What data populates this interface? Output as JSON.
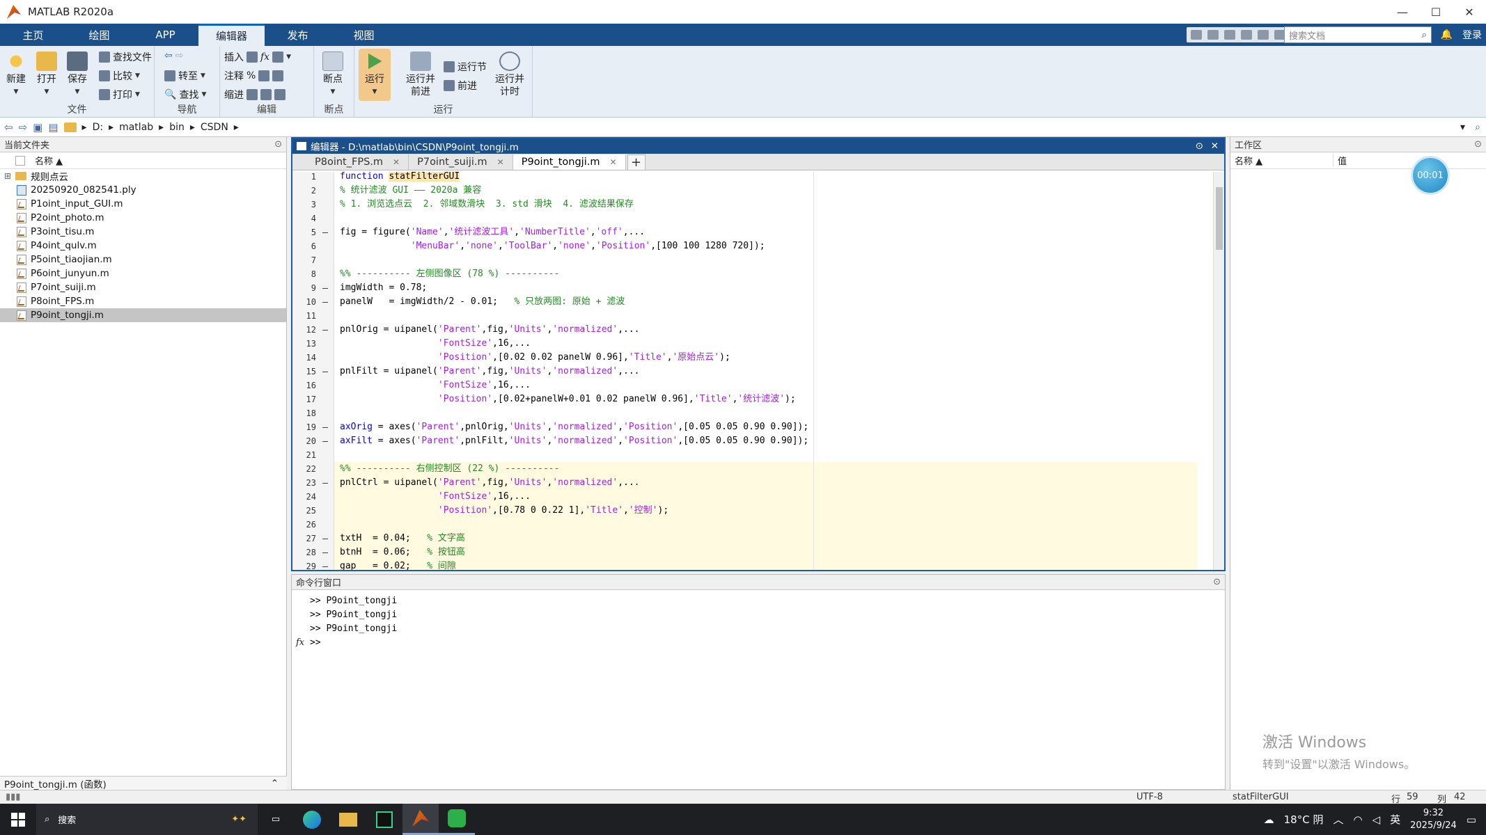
{
  "window": {
    "title": "MATLAB R2020a"
  },
  "ribbon_tabs": [
    "主页",
    "绘图",
    "APP",
    "编辑器",
    "发布",
    "视图"
  ],
  "active_tab": "编辑器",
  "search": {
    "placeholder": "搜索文档"
  },
  "login_label": "登录",
  "ribbon": {
    "file_group": {
      "label": "文件",
      "new": "新建",
      "open": "打开",
      "save": "保存",
      "find_files": "查找文件",
      "compare": "比较",
      "print": "打印"
    },
    "nav_group": {
      "label": "导航",
      "goto": "转至",
      "find": "查找"
    },
    "edit_group": {
      "label": "编辑",
      "insert": "插入",
      "comment": "注释",
      "indent": "缩进",
      "fx": "fx",
      "percent": "%"
    },
    "breakpoints_group": {
      "label": "断点",
      "breakpoints": "断点"
    },
    "run_group": {
      "label": "运行",
      "run": "运行",
      "run_advance_1": "运行并",
      "run_advance_2": "前进",
      "run_section": "运行节",
      "advance": "前进",
      "run_time_1": "运行并",
      "run_time_2": "计时"
    }
  },
  "address": {
    "path": [
      "D:",
      "matlab",
      "bin",
      "CSDN"
    ]
  },
  "current_folder": {
    "title": "当前文件夹",
    "col_name": "名称 ▲",
    "items": [
      {
        "name": "规则点云",
        "kind": "folder"
      },
      {
        "name": "20250920_082541.ply",
        "kind": "ply"
      },
      {
        "name": "P1oint_input_GUI.m",
        "kind": "m"
      },
      {
        "name": "P2oint_photo.m",
        "kind": "m"
      },
      {
        "name": "P3oint_tisu.m",
        "kind": "m"
      },
      {
        "name": "P4oint_qulv.m",
        "kind": "m"
      },
      {
        "name": "P5oint_tiaojian.m",
        "kind": "m"
      },
      {
        "name": "P6oint_junyun.m",
        "kind": "m"
      },
      {
        "name": "P7oint_suiji.m",
        "kind": "m"
      },
      {
        "name": "P8oint_FPS.m",
        "kind": "m"
      },
      {
        "name": "P9oint_tongji.m",
        "kind": "m",
        "selected": true
      }
    ],
    "details": "P9oint_tongji.m  (函数)"
  },
  "editor": {
    "title": "编辑器 - D:\\matlab\\bin\\CSDN\\P9oint_tongji.m",
    "tabs": [
      {
        "label": "P8oint_FPS.m"
      },
      {
        "label": "P7oint_suiji.m"
      },
      {
        "label": "P9oint_tongji.m",
        "active": true
      }
    ],
    "plus": "+",
    "lines": [
      {
        "n": "1",
        "bp": "",
        "code": [
          [
            "kw",
            "function "
          ],
          [
            "name",
            "statFilterGUI"
          ]
        ]
      },
      {
        "n": "2",
        "bp": "",
        "code": [
          [
            "cm",
            "% 统计滤波 GUI —— 2020a 兼容"
          ]
        ]
      },
      {
        "n": "3",
        "bp": "",
        "code": [
          [
            "cm",
            "% 1. 浏览选点云  2. 邻域数滑块  3. std 滑块  4. 滤波结果保存"
          ]
        ]
      },
      {
        "n": "4",
        "bp": "",
        "code": []
      },
      {
        "n": "5",
        "bp": "–",
        "code": [
          [
            "t",
            "fig = figure("
          ],
          [
            "str",
            "'Name'"
          ],
          [
            "t",
            ","
          ],
          [
            "str",
            "'统计滤波工具'"
          ],
          [
            "t",
            ","
          ],
          [
            "str",
            "'NumberTitle'"
          ],
          [
            "t",
            ","
          ],
          [
            "str",
            "'off'"
          ],
          [
            "t",
            ",..."
          ]
        ]
      },
      {
        "n": "6",
        "bp": "",
        "code": [
          [
            "t",
            "             "
          ],
          [
            "str",
            "'MenuBar'"
          ],
          [
            "t",
            ","
          ],
          [
            "str",
            "'none'"
          ],
          [
            "t",
            ","
          ],
          [
            "str",
            "'ToolBar'"
          ],
          [
            "t",
            ","
          ],
          [
            "str",
            "'none'"
          ],
          [
            "t",
            ","
          ],
          [
            "str",
            "'Position'"
          ],
          [
            "t",
            ",[100 100 1280 720]);"
          ]
        ]
      },
      {
        "n": "7",
        "bp": "",
        "code": []
      },
      {
        "n": "8",
        "bp": "",
        "code": [
          [
            "cm",
            "%% ---------- 左侧图像区 (78 %) ----------"
          ]
        ]
      },
      {
        "n": "9",
        "bp": "–",
        "code": [
          [
            "t",
            "imgWidth = 0.78;"
          ]
        ]
      },
      {
        "n": "10",
        "bp": "–",
        "code": [
          [
            "t",
            "panelW   = imgWidth/2 - 0.01;   "
          ],
          [
            "cm",
            "% 只放两图: 原始 + 滤波"
          ]
        ]
      },
      {
        "n": "11",
        "bp": "",
        "code": []
      },
      {
        "n": "12",
        "bp": "–",
        "code": [
          [
            "t",
            "pnlOrig = uipanel("
          ],
          [
            "str",
            "'Parent'"
          ],
          [
            "t",
            ",fig,"
          ],
          [
            "str",
            "'Units'"
          ],
          [
            "t",
            ","
          ],
          [
            "str",
            "'normalized'"
          ],
          [
            "t",
            ",..."
          ]
        ]
      },
      {
        "n": "13",
        "bp": "",
        "code": [
          [
            "t",
            "                  "
          ],
          [
            "str",
            "'FontSize'"
          ],
          [
            "t",
            ",16,..."
          ]
        ]
      },
      {
        "n": "14",
        "bp": "",
        "code": [
          [
            "t",
            "                  "
          ],
          [
            "str",
            "'Position'"
          ],
          [
            "t",
            ",[0.02 0.02 panelW 0.96],"
          ],
          [
            "str",
            "'Title'"
          ],
          [
            "t",
            ","
          ],
          [
            "str",
            "'原始点云'"
          ],
          [
            "t",
            ");"
          ]
        ]
      },
      {
        "n": "15",
        "bp": "–",
        "code": [
          [
            "t",
            "pnlFilt = uipanel("
          ],
          [
            "str",
            "'Parent'"
          ],
          [
            "t",
            ",fig,"
          ],
          [
            "str",
            "'Units'"
          ],
          [
            "t",
            ","
          ],
          [
            "str",
            "'normalized'"
          ],
          [
            "t",
            ",..."
          ]
        ]
      },
      {
        "n": "16",
        "bp": "",
        "code": [
          [
            "t",
            "                  "
          ],
          [
            "str",
            "'FontSize'"
          ],
          [
            "t",
            ",16,..."
          ]
        ]
      },
      {
        "n": "17",
        "bp": "",
        "code": [
          [
            "t",
            "                  "
          ],
          [
            "str",
            "'Position'"
          ],
          [
            "t",
            ",[0.02+panelW+0.01 0.02 panelW 0.96],"
          ],
          [
            "str",
            "'Title'"
          ],
          [
            "t",
            ","
          ],
          [
            "str",
            "'统计滤波'"
          ],
          [
            "t",
            ");"
          ]
        ]
      },
      {
        "n": "18",
        "bp": "",
        "code": []
      },
      {
        "n": "19",
        "bp": "–",
        "code": [
          [
            "kw2",
            "axOrig"
          ],
          [
            "t",
            " = axes("
          ],
          [
            "str",
            "'Parent'"
          ],
          [
            "t",
            ",pnlOrig,"
          ],
          [
            "str",
            "'Units'"
          ],
          [
            "t",
            ","
          ],
          [
            "str",
            "'normalized'"
          ],
          [
            "t",
            ","
          ],
          [
            "str",
            "'Position'"
          ],
          [
            "t",
            ",[0.05 0.05 0.90 0.90]);"
          ]
        ]
      },
      {
        "n": "20",
        "bp": "–",
        "code": [
          [
            "kw2",
            "axFilt"
          ],
          [
            "t",
            " = axes("
          ],
          [
            "str",
            "'Parent'"
          ],
          [
            "t",
            ",pnlFilt,"
          ],
          [
            "str",
            "'Units'"
          ],
          [
            "t",
            ","
          ],
          [
            "str",
            "'normalized'"
          ],
          [
            "t",
            ","
          ],
          [
            "str",
            "'Position'"
          ],
          [
            "t",
            ",[0.05 0.05 0.90 0.90]);"
          ]
        ]
      },
      {
        "n": "21",
        "bp": "",
        "code": []
      },
      {
        "n": "22",
        "bp": "",
        "cell": true,
        "code": [
          [
            "cm",
            "%% ---------- 右侧控制区 (22 %) ----------"
          ]
        ]
      },
      {
        "n": "23",
        "bp": "–",
        "cell": true,
        "code": [
          [
            "t",
            "pnlCtrl = uipanel("
          ],
          [
            "str",
            "'Parent'"
          ],
          [
            "t",
            ",fig,"
          ],
          [
            "str",
            "'Units'"
          ],
          [
            "t",
            ","
          ],
          [
            "str",
            "'normalized'"
          ],
          [
            "t",
            ",..."
          ]
        ]
      },
      {
        "n": "24",
        "bp": "",
        "cell": true,
        "code": [
          [
            "t",
            "                  "
          ],
          [
            "str",
            "'FontSize'"
          ],
          [
            "t",
            ",16,..."
          ]
        ]
      },
      {
        "n": "25",
        "bp": "",
        "cell": true,
        "code": [
          [
            "t",
            "                  "
          ],
          [
            "str",
            "'Position'"
          ],
          [
            "t",
            ",[0.78 0 0.22 1],"
          ],
          [
            "str",
            "'Title'"
          ],
          [
            "t",
            ","
          ],
          [
            "str",
            "'控制'"
          ],
          [
            "t",
            ");"
          ]
        ]
      },
      {
        "n": "26",
        "bp": "",
        "cell": true,
        "code": []
      },
      {
        "n": "27",
        "bp": "–",
        "cell": true,
        "code": [
          [
            "t",
            "txtH  = 0.04;   "
          ],
          [
            "cm",
            "% 文字高"
          ]
        ]
      },
      {
        "n": "28",
        "bp": "–",
        "cell": true,
        "code": [
          [
            "t",
            "btnH  = 0.06;   "
          ],
          [
            "cm",
            "% 按钮高"
          ]
        ]
      },
      {
        "n": "29",
        "bp": "–",
        "cell": true,
        "code": [
          [
            "t",
            "gap   = 0.02;   "
          ],
          [
            "cm",
            "% 间隙"
          ]
        ]
      }
    ]
  },
  "command_window": {
    "title": "命令行窗口",
    "history": [
      ">> P9oint_tongji",
      ">> P9oint_tongji",
      ">> P9oint_tongji"
    ],
    "prompt": ">>",
    "fx": "fx"
  },
  "workspace": {
    "title": "工作区",
    "col_name": "名称 ▲",
    "col_value": "值",
    "timer": "00:01",
    "watermark_1": "激活 Windows",
    "watermark_2": "转到\"设置\"以激活 Windows。"
  },
  "status": {
    "encoding": "UTF-8",
    "function": "statFilterGUI",
    "row_label": "行",
    "row": "59",
    "col_label": "列",
    "col": "42"
  },
  "taskbar": {
    "search": "搜索",
    "weather": "18°C 阴",
    "ime": "英",
    "time": "9:32",
    "date": "2025/9/24"
  },
  "colors": {
    "ribbon_blue": "#1b4f8a",
    "editor_border": "#1b5bb5",
    "string_purple": "#a020f0",
    "comment_green": "#228b22",
    "keyword_blue": "#0000ff"
  }
}
